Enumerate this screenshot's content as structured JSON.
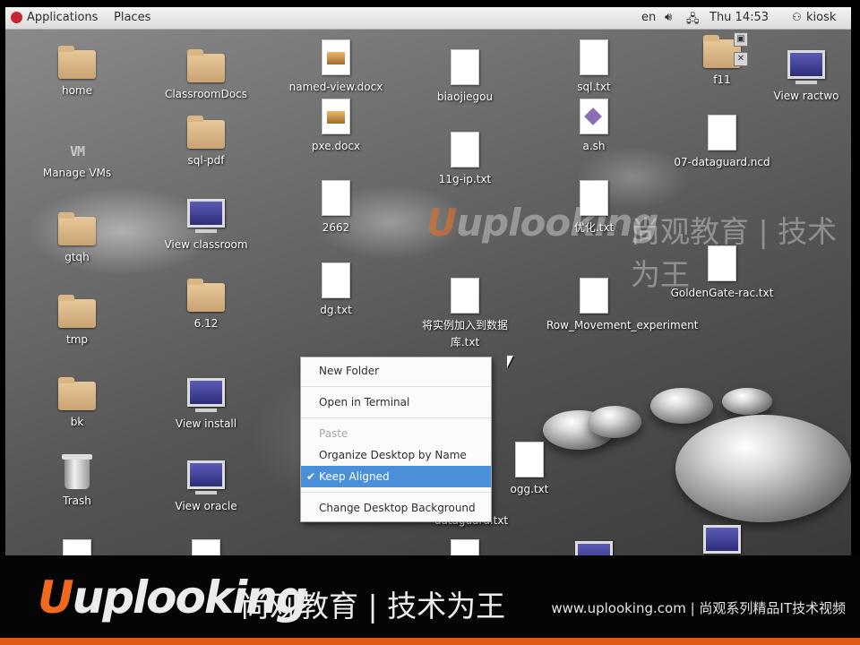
{
  "top_panel": {
    "applications": "Applications",
    "places": "Places",
    "input_lang": "en",
    "clock": "Thu 14:53",
    "user": "kiosk"
  },
  "watermark": {
    "brand": "uplooking",
    "slogan": "尚观教育 | 技术为王"
  },
  "desktop_icons": {
    "home": "home",
    "classroomdocs": "ClassroomDocs",
    "named_view": "named-view.docx",
    "biaojiegou": "biaojiegou",
    "sql_txt": "sql.txt",
    "f11": "f11",
    "view_ractwo": "View ractwo",
    "manage_vms": "Manage VMs",
    "sql_pdf": "sql-pdf",
    "pxe_docx": "pxe.docx",
    "a_sh": "a.sh",
    "dataguard_ncd": "07-dataguard.ncd",
    "ip_txt": "11g-ip.txt",
    "gtqh": "gtqh",
    "view_classroom": "View classroom",
    "n2662": "2662",
    "youhua": "优化.txt",
    "goldengate": "GoldenGate-rac.txt",
    "tmp": "tmp",
    "n612": "6.12",
    "dg_txt": "dg.txt",
    "shili": "将实例加入到数据库.txt",
    "row_movement": "Row_Movement_experiment",
    "bk": "bk",
    "view_install": "View install",
    "trash": "Trash",
    "view_oracle": "View oracle",
    "ogg_txt": "ogg.txt",
    "dataguard_txt": "dataguard.txt"
  },
  "context_menu": {
    "new_folder": "New Folder",
    "open_terminal": "Open in Terminal",
    "paste": "Paste",
    "organize": "Organize Desktop by Name",
    "keep_aligned": "Keep Aligned",
    "change_bg": "Change Desktop Background"
  },
  "banner": {
    "brand": "uplooking",
    "slogan": "尚观教育 | 技术为王",
    "url": "www.uplooking.com | 尚观系列精品IT技术视频"
  }
}
